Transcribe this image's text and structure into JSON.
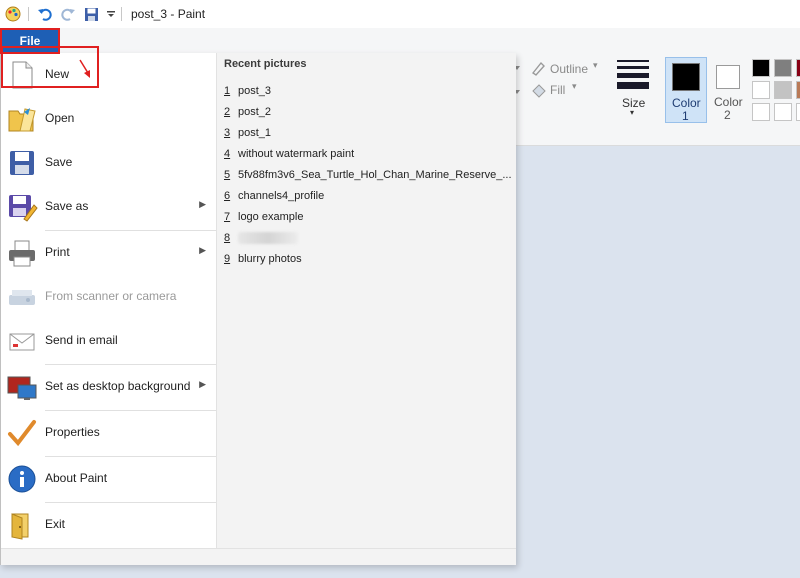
{
  "titlebar": {
    "title": "post_3 - Paint"
  },
  "ribbon": {
    "file_tab": "File",
    "outline_label": "Outline",
    "fill_label": "Fill",
    "size_label": "Size",
    "color1_label": "Color",
    "color1_num": "1",
    "color2_label": "Color",
    "color2_num": "2",
    "colors": {
      "color1": "#000000",
      "color2": "#ffffff"
    }
  },
  "file_menu": {
    "items": [
      {
        "label": "New",
        "icon": "new-document-icon"
      },
      {
        "label": "Open",
        "icon": "open-folder-icon"
      },
      {
        "label": "Save",
        "icon": "save-disk-icon"
      },
      {
        "label": "Save as",
        "icon": "save-as-icon",
        "submenu": true
      },
      {
        "label": "Print",
        "icon": "printer-icon",
        "submenu": true
      },
      {
        "label": "From scanner or camera",
        "icon": "scanner-icon",
        "disabled": true
      },
      {
        "label": "Send in email",
        "icon": "email-icon"
      },
      {
        "label": "Set as desktop background",
        "icon": "desktop-background-icon",
        "submenu": true
      },
      {
        "label": "Properties",
        "icon": "properties-check-icon"
      },
      {
        "label": "About Paint",
        "icon": "info-icon"
      },
      {
        "label": "Exit",
        "icon": "exit-icon"
      }
    ],
    "recent_header": "Recent pictures",
    "recent": [
      {
        "num": "1",
        "name": "post_3"
      },
      {
        "num": "2",
        "name": "post_2"
      },
      {
        "num": "3",
        "name": "post_1"
      },
      {
        "num": "4",
        "name": "without watermark paint"
      },
      {
        "num": "5",
        "name": "5fv88fm3v6_Sea_Turtle_Hol_Chan_Marine_Reserve_..."
      },
      {
        "num": "6",
        "name": "channels4_profile"
      },
      {
        "num": "7",
        "name": "logo example"
      },
      {
        "num": "8",
        "name": ""
      },
      {
        "num": "9",
        "name": "blurry photos"
      }
    ]
  },
  "palette": [
    "#000000",
    "#7f7f7f",
    "#880015",
    "#ffffff",
    "#c3c3c3",
    "#b97a57",
    "#ffffff",
    "#ffffff",
    "#ffffff"
  ]
}
